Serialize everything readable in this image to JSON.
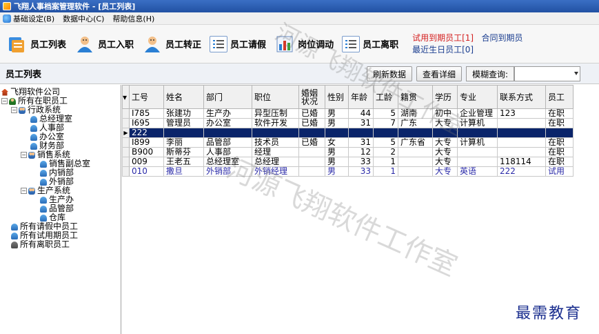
{
  "window": {
    "title": "飞翔人事档案管理软件 - [员工列表]"
  },
  "menu": {
    "items": [
      "基础设定(B)",
      "数据中心(C)",
      "帮助信息(H)"
    ]
  },
  "toolbar": {
    "buttons": [
      "员工列表",
      "员工入职",
      "员工转正",
      "员工请假",
      "岗位调动",
      "员工离职"
    ],
    "alerts": {
      "probation_due": "试用到期员工[1]",
      "contract_due": "合同到期员",
      "birthday": "最近生日员工[0]"
    }
  },
  "section": {
    "title": "员工列表",
    "refresh_label": "刷新数据",
    "detail_label": "查看详细",
    "search_label": "模糊查询:",
    "search_value": ""
  },
  "tree": {
    "nodes": [
      "飞翔软件公司",
      "所有在职员工",
      "行政系统",
      "总经理室",
      "人事部",
      "办公室",
      "财务部",
      "销售系统",
      "销售副总室",
      "内销部",
      "外销部",
      "生产系统",
      "生产办",
      "品管部",
      "仓库",
      "所有请假中员工",
      "所有试用期员工",
      "所有离职员工"
    ]
  },
  "grid": {
    "columns": [
      "工号",
      "姓名",
      "部门",
      "职位",
      "婚姻\n状况",
      "性别",
      "年龄",
      "工龄",
      "籍贯",
      "学历",
      "专业",
      "联系方式",
      "员工"
    ],
    "rows": [
      [
        "I785",
        "张建功",
        "生产办",
        "异型压制",
        "已婚",
        "男",
        "44",
        "5",
        "湖南",
        "初中",
        "企业管理",
        "123",
        "在职"
      ],
      [
        "I695",
        "管理员",
        "办公室",
        "软件开发",
        "已婚",
        "男",
        "31",
        "7",
        "广东",
        "大专",
        "计算机",
        "",
        "在职"
      ],
      [
        "222",
        "",
        "",
        "",
        "",
        "",
        "",
        "",
        "",
        "",
        "",
        "",
        ""
      ],
      [
        "I899",
        "李丽",
        "品管部",
        "技术员",
        "已婚",
        "女",
        "31",
        "5",
        "广东省",
        "大专",
        "计算机",
        "",
        "在职"
      ],
      [
        "B900",
        "斯蒂芬",
        "人事部",
        "经理",
        "",
        "男",
        "12",
        "2",
        "",
        "大专",
        "",
        "",
        "在职"
      ],
      [
        "009",
        "王老五",
        "总经理室",
        "总经理",
        "",
        "男",
        "33",
        "1",
        "",
        "大专",
        "",
        "118114",
        "在职"
      ],
      [
        "010",
        "撒旦",
        "外销部",
        "外销经理",
        "",
        "男",
        "33",
        "1",
        "",
        "大专",
        "英语",
        "222",
        "试用"
      ]
    ]
  },
  "watermark": {
    "line1": "河源飞翔软件工作室",
    "line2": "河源飞翔软件工作室"
  },
  "brand": "最需教育"
}
